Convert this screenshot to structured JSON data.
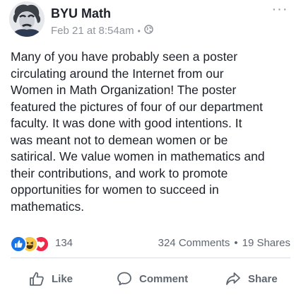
{
  "post": {
    "author": "BYU Math",
    "timestamp": "Feb 21 at 8:54am",
    "separator": "•",
    "audience_icon": "globe-icon",
    "more_label": "···",
    "text": "Many of you have probably seen a poster\ncirculating around the Internet from our\nWomen in Math Organization! The poster\nfeatured the pictures of four of our department\nfaculty. It was done with good intentions.  It\nwas meant not to demean women or be\nsatirical. We value women in mathematics and\ntheir contributions, and work to promote\nopportunities for women to succeed in\nmathematics."
  },
  "stats": {
    "reaction_icons": [
      "like-reaction-icon",
      "haha-reaction-icon",
      "love-reaction-icon"
    ],
    "reaction_count": "134",
    "comments": "324 Comments",
    "separator": "•",
    "shares": "19 Shares"
  },
  "actions": [
    {
      "label": "Like",
      "icon": "thumbs-up-icon"
    },
    {
      "label": "Comment",
      "icon": "comment-bubble-icon"
    },
    {
      "label": "Share",
      "icon": "share-arrow-icon"
    }
  ],
  "colors": {
    "like_blue": "#1b74e4",
    "haha_yellow": "#f7c94b",
    "love_red": "#f0284a",
    "meta_gray": "#90949c",
    "text": "#1d2129"
  }
}
